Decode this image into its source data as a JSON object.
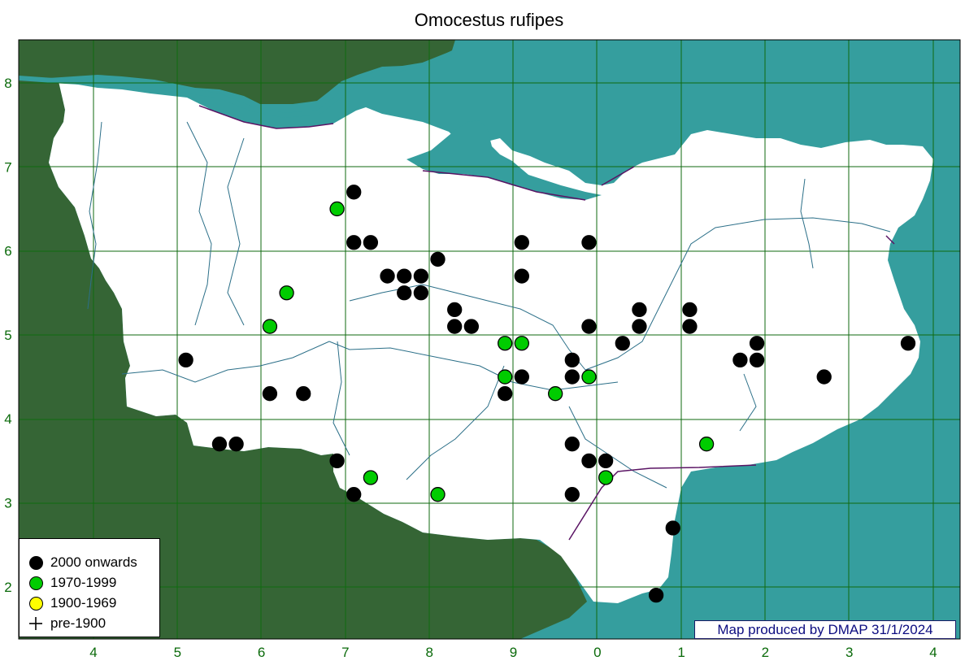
{
  "title": "Omocestus rufipes",
  "colors": {
    "sea": "#359e9e",
    "outside_land": "#356535",
    "county": "#ffffff",
    "grid": "#0f6a0f",
    "river": "#2b6f88",
    "boundary": "#5a1464",
    "dot_2000": "#000000",
    "dot_1970": "#00cc00",
    "dot_1900": "#ffff00"
  },
  "x_tick_labels": [
    "4",
    "5",
    "6",
    "7",
    "8",
    "9",
    "0",
    "1",
    "2",
    "3",
    "4"
  ],
  "y_tick_labels": [
    "8",
    "7",
    "6",
    "5",
    "4",
    "3",
    "2"
  ],
  "legend": [
    {
      "label": "2000 onwards",
      "symbol": "black-dot-icon"
    },
    {
      "label": "1970-1999",
      "symbol": "green-dot-icon"
    },
    {
      "label": "1900-1969",
      "symbol": "yellow-dot-icon"
    },
    {
      "label": "pre-1900",
      "symbol": "plus-icon"
    }
  ],
  "credit": "Map produced by DMAP 31/1/2024",
  "records": {
    "2000_onwards": [
      [
        7.1,
        6.7
      ],
      [
        7.1,
        6.1
      ],
      [
        7.3,
        6.1
      ],
      [
        9.1,
        6.1
      ],
      [
        9.9,
        6.1
      ],
      [
        8.1,
        5.9
      ],
      [
        7.5,
        5.7
      ],
      [
        7.7,
        5.7
      ],
      [
        7.9,
        5.7
      ],
      [
        9.1,
        5.7
      ],
      [
        7.7,
        5.5
      ],
      [
        7.9,
        5.5
      ],
      [
        8.3,
        5.3
      ],
      [
        10.5,
        5.3
      ],
      [
        11.1,
        5.3
      ],
      [
        8.3,
        5.1
      ],
      [
        8.5,
        5.1
      ],
      [
        9.9,
        5.1
      ],
      [
        10.5,
        5.1
      ],
      [
        11.1,
        5.1
      ],
      [
        10.3,
        4.9
      ],
      [
        11.9,
        4.9
      ],
      [
        13.7,
        4.9
      ],
      [
        5.1,
        4.7
      ],
      [
        9.7,
        4.7
      ],
      [
        11.7,
        4.7
      ],
      [
        11.9,
        4.7
      ],
      [
        9.1,
        4.5
      ],
      [
        9.7,
        4.5
      ],
      [
        12.7,
        4.5
      ],
      [
        6.1,
        4.3
      ],
      [
        6.5,
        4.3
      ],
      [
        8.9,
        4.3
      ],
      [
        5.5,
        3.7
      ],
      [
        5.7,
        3.7
      ],
      [
        9.7,
        3.7
      ],
      [
        6.9,
        3.5
      ],
      [
        9.9,
        3.5
      ],
      [
        10.1,
        3.5
      ],
      [
        7.1,
        3.1
      ],
      [
        9.7,
        3.1
      ],
      [
        10.9,
        2.7
      ],
      [
        10.7,
        1.9
      ]
    ],
    "1970_1999": [
      [
        6.9,
        6.5
      ],
      [
        6.3,
        5.5
      ],
      [
        6.1,
        5.1
      ],
      [
        8.9,
        4.9
      ],
      [
        9.1,
        4.9
      ],
      [
        8.9,
        4.5
      ],
      [
        9.9,
        4.5
      ],
      [
        9.5,
        4.3
      ],
      [
        11.3,
        3.7
      ],
      [
        7.3,
        3.3
      ],
      [
        10.1,
        3.3
      ],
      [
        8.1,
        3.1
      ]
    ],
    "1900_1969": [],
    "pre_1900": []
  }
}
